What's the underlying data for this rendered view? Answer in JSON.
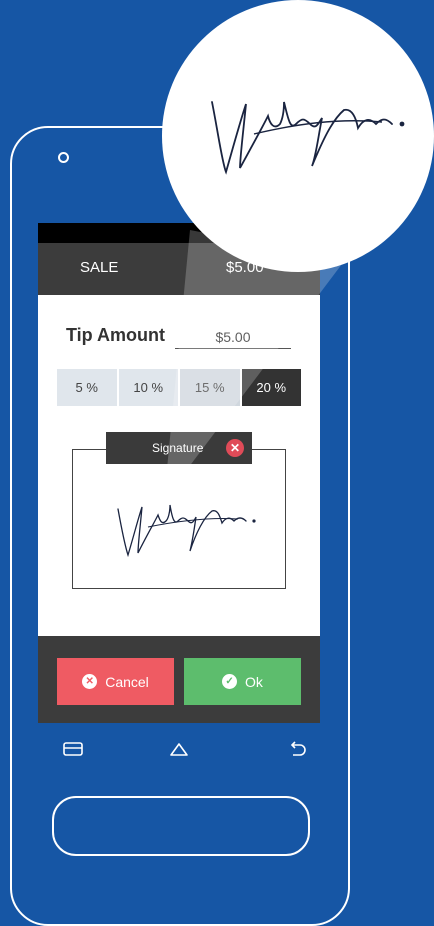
{
  "app": {
    "transaction_type": "SALE",
    "amount": "$5.00"
  },
  "tip": {
    "label": "Tip Amount",
    "value": "$5.00",
    "options": [
      {
        "label": "5 %",
        "selected": false
      },
      {
        "label": "10 %",
        "selected": false
      },
      {
        "label": "15 %",
        "selected": false
      },
      {
        "label": "20 %",
        "selected": true
      }
    ]
  },
  "signature": {
    "tab_label": "Signature",
    "close_icon": "close-circle-icon"
  },
  "actions": {
    "cancel_label": "Cancel",
    "ok_label": "Ok"
  },
  "nav": {
    "icons": [
      "menu-icon",
      "home-icon",
      "back-icon"
    ]
  },
  "colors": {
    "background": "#1656a5",
    "cancel": "#ef5b63",
    "ok": "#5dbd6d",
    "bar": "#3c3c3c",
    "selected_tip": "#333333"
  }
}
